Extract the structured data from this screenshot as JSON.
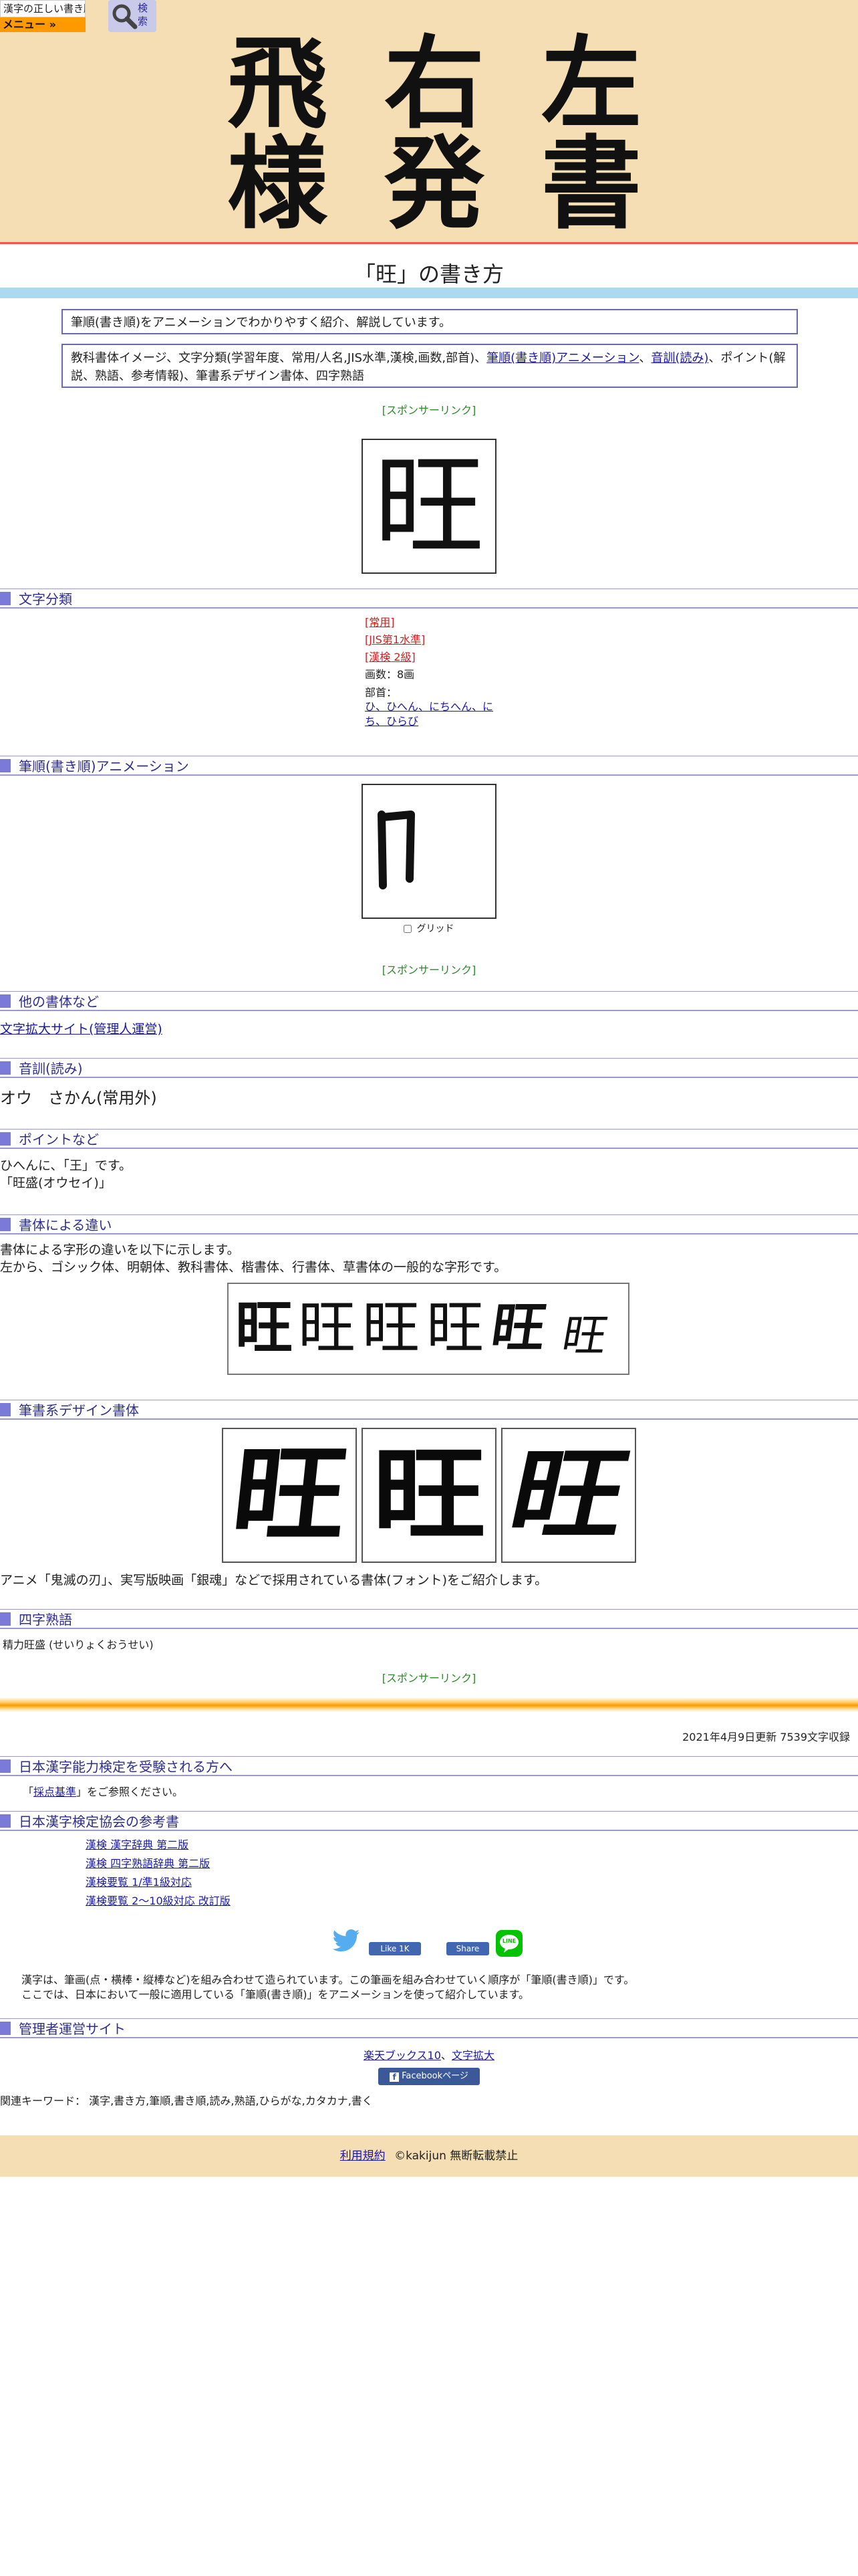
{
  "header": {
    "logo_mini_text": "漢字の正しい書き順(筆順)",
    "menu_label": "メニュー »",
    "search_label": "検索",
    "logo_chars_row1": [
      "飛",
      "右",
      "左"
    ],
    "logo_chars_row2": [
      "様",
      "発",
      "書"
    ]
  },
  "page_title": "「旺」の書き方",
  "intro_box": "筆順(書き順)をアニメーションでわかりやすく紹介、解説しています。",
  "contents_box": {
    "text_a": "教科書体イメージ、文字分類(学習年度、常用/人名,JIS水準,漢検,画数,部首)、",
    "link_stroke": "筆順(書き順)アニメーション",
    "sep": "、",
    "link_reading": "音訓(読み)",
    "text_b": "、ポイント(解説、熟語、参考情報)、筆書系デザイン書体、四字熟語"
  },
  "sponsor_link": "[スポンサーリンク]",
  "kanji": "旺",
  "stroke_partial": "⼌",
  "sections": {
    "classification": "文字分類",
    "stroke_animation": "筆順(書き順)アニメーション",
    "other_fonts": "他の書体など",
    "reading": "音訓(読み)",
    "points": "ポイントなど",
    "font_diff": "書体による違い",
    "design_font": "筆書系デザイン書体",
    "yoji": "四字熟語",
    "kentei": "日本漢字能力検定を受験される方へ",
    "kyokai": "日本漢字検定協会の参考書",
    "admin": "管理者運営サイト"
  },
  "classification": {
    "joyo": "[常用]",
    "jis": "[JIS第1水準]",
    "kanken": "[漢検 2級]",
    "strokes": "画数：8画",
    "radical_label": "部首：",
    "radical_line1": "ひ、ひへん、にちへん、に",
    "radical_line2": "ち、ひらび"
  },
  "grid_label": "グリッド",
  "other_fonts_link": "文字拡大サイト(管理人運営)",
  "reading_text": "オウ　さかん(常用外)",
  "points": {
    "line1": "ひへんに、「王」です。",
    "line2": "「旺盛(オウセイ)」"
  },
  "font_diff": {
    "line1": "書体による字形の違いを以下に示します。",
    "line2": "左から、ゴシック体、明朝体、教科書体、楷書体、行書体、草書体の一般的な字形です。"
  },
  "design_note": "アニメ「鬼滅の刃」、実写版映画「銀魂」などで採用されている書体(フォント)をご紹介します。",
  "yoji_text": "精力旺盛 (せいりょくおうせい)",
  "updated": "2021年4月9日更新 7539文字収録",
  "kentei": {
    "prefix": "「",
    "link": "採点基準",
    "suffix": "」をご参照ください。"
  },
  "books": [
    "漢検 漢字辞典 第二版",
    "漢検 四字熟語辞典 第二版",
    "漢検要覧 1/準1級対応",
    "漢検要覧 2～10級対応 改訂版"
  ],
  "social": {
    "fb_like": "Like 1K",
    "fb_share": "Share",
    "line": "LINE"
  },
  "description": {
    "line1": "漢字は、筆画(点・横棒・縦棒など)を組み合わせて造られています。この筆画を組み合わせていく順序が「筆順(書き順)」です。",
    "line2": "ここでは、日本において一般に適用している「筆順(書き順)」をアニメーションを使って紹介しています。"
  },
  "admin_links": {
    "rakuten": "楽天ブックス10",
    "sep": "、",
    "kakudai": "文字拡大",
    "facebook": "Facebookページ"
  },
  "keywords": "関連キーワード： 漢字,書き方,筆順,書き順,読み,熟語,ひらがな,カタカナ,書く",
  "footer": {
    "terms": "利用規約",
    "copyright": "©kakijun 無断転載禁止"
  },
  "colors": {
    "header_bg": "#f5deb3",
    "section_mark": "#7a7ad9",
    "sponsor": "#2a8a2a",
    "link": "#1a1aa6",
    "orange": "#ff9900"
  }
}
